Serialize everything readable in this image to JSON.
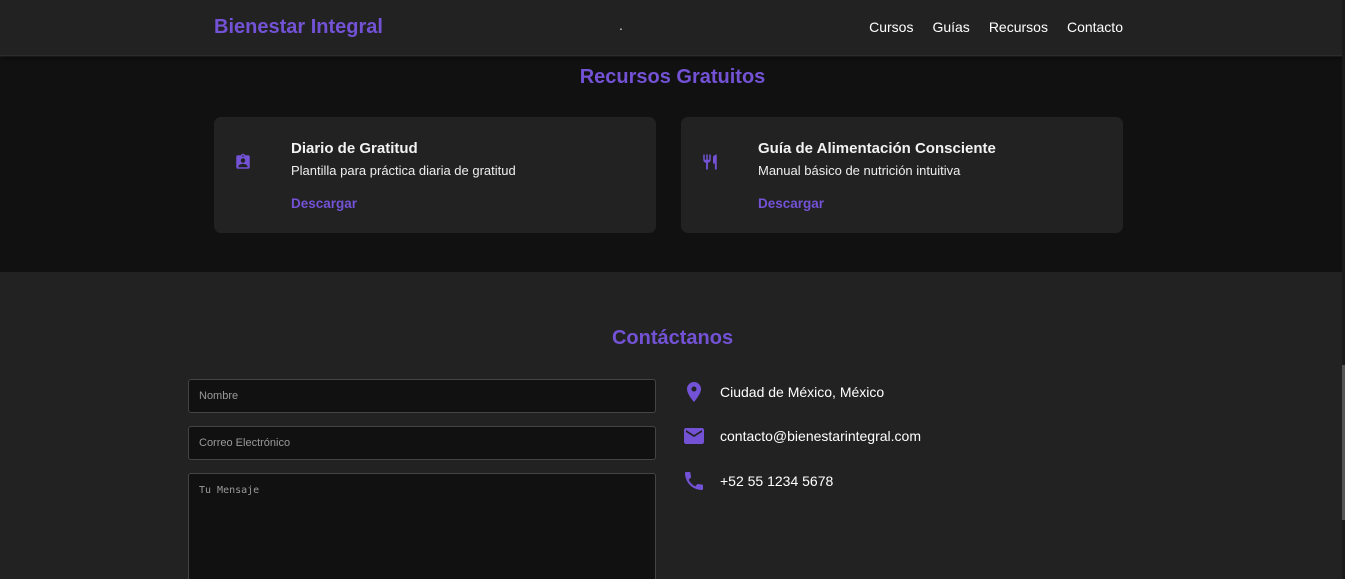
{
  "nav": {
    "brand": "Bienestar Integral",
    "dot": ".",
    "links": [
      "Cursos",
      "Guías",
      "Recursos",
      "Contacto"
    ]
  },
  "resources": {
    "title": "Recursos Gratuitos",
    "cards": [
      {
        "icon": "clipboard-account-icon",
        "title": "Diario de Gratitud",
        "description": "Plantilla para práctica diaria de gratitud",
        "link": "Descargar"
      },
      {
        "icon": "utensils-icon",
        "title": "Guía de Alimentación Consciente",
        "description": "Manual básico de nutrición intuitiva",
        "link": "Descargar"
      }
    ]
  },
  "contact": {
    "title": "Contáctanos",
    "form": {
      "name_placeholder": "Nombre",
      "email_placeholder": "Correo Electrónico",
      "message_placeholder": "Tu Mensaje"
    },
    "info": [
      {
        "icon": "location-pin-icon",
        "text": "Ciudad de México, México"
      },
      {
        "icon": "email-icon",
        "text": "contacto@bienestarintegral.com"
      },
      {
        "icon": "phone-icon",
        "text": "+52 55 1234 5678"
      }
    ]
  },
  "colors": {
    "accent": "#7352d6",
    "background_dark": "#111111",
    "background": "#222222",
    "text": "#ffffff"
  }
}
